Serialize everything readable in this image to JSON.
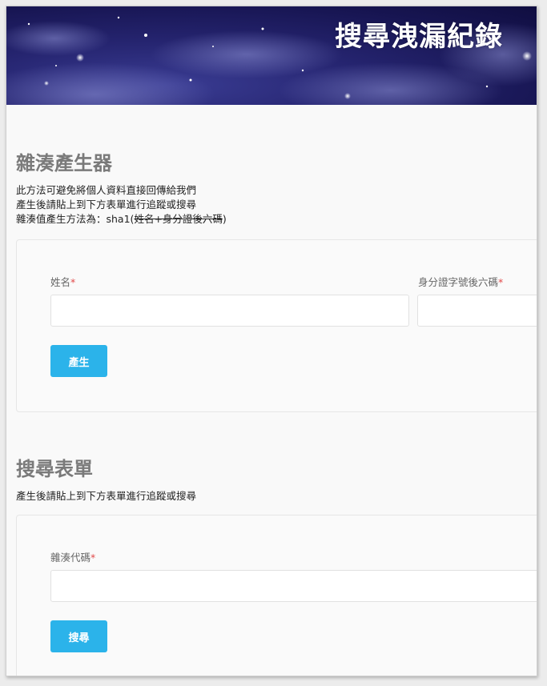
{
  "banner": {
    "title": "搜尋洩漏紀錄"
  },
  "generator": {
    "title": "雜湊產生器",
    "desc_line1": "此方法可避免將個人資料直接回傳給我們",
    "desc_line2": "產生後請貼上到下方表單進行追蹤或搜尋",
    "desc_line3_prefix": "雜湊值產生方法為：sha1(",
    "desc_line3_struck": "姓名+身分證後六碼",
    "desc_line3_suffix": ")",
    "name_label": "姓名",
    "id_label": "身分證字號後六碼",
    "required_mark": "*",
    "name_value": "",
    "id_value": "",
    "submit_label": "產生"
  },
  "search": {
    "title": "搜尋表單",
    "desc": "產生後請貼上到下方表單進行追蹤或搜尋",
    "hash_label": "雜湊代碼",
    "required_mark": "*",
    "hash_value": "",
    "submit_label": "搜尋"
  },
  "colors": {
    "accent": "#2bb3ea",
    "required": "#e24a4a",
    "section_title": "#7a7a7a",
    "banner_bg": "#1c1a5c"
  }
}
